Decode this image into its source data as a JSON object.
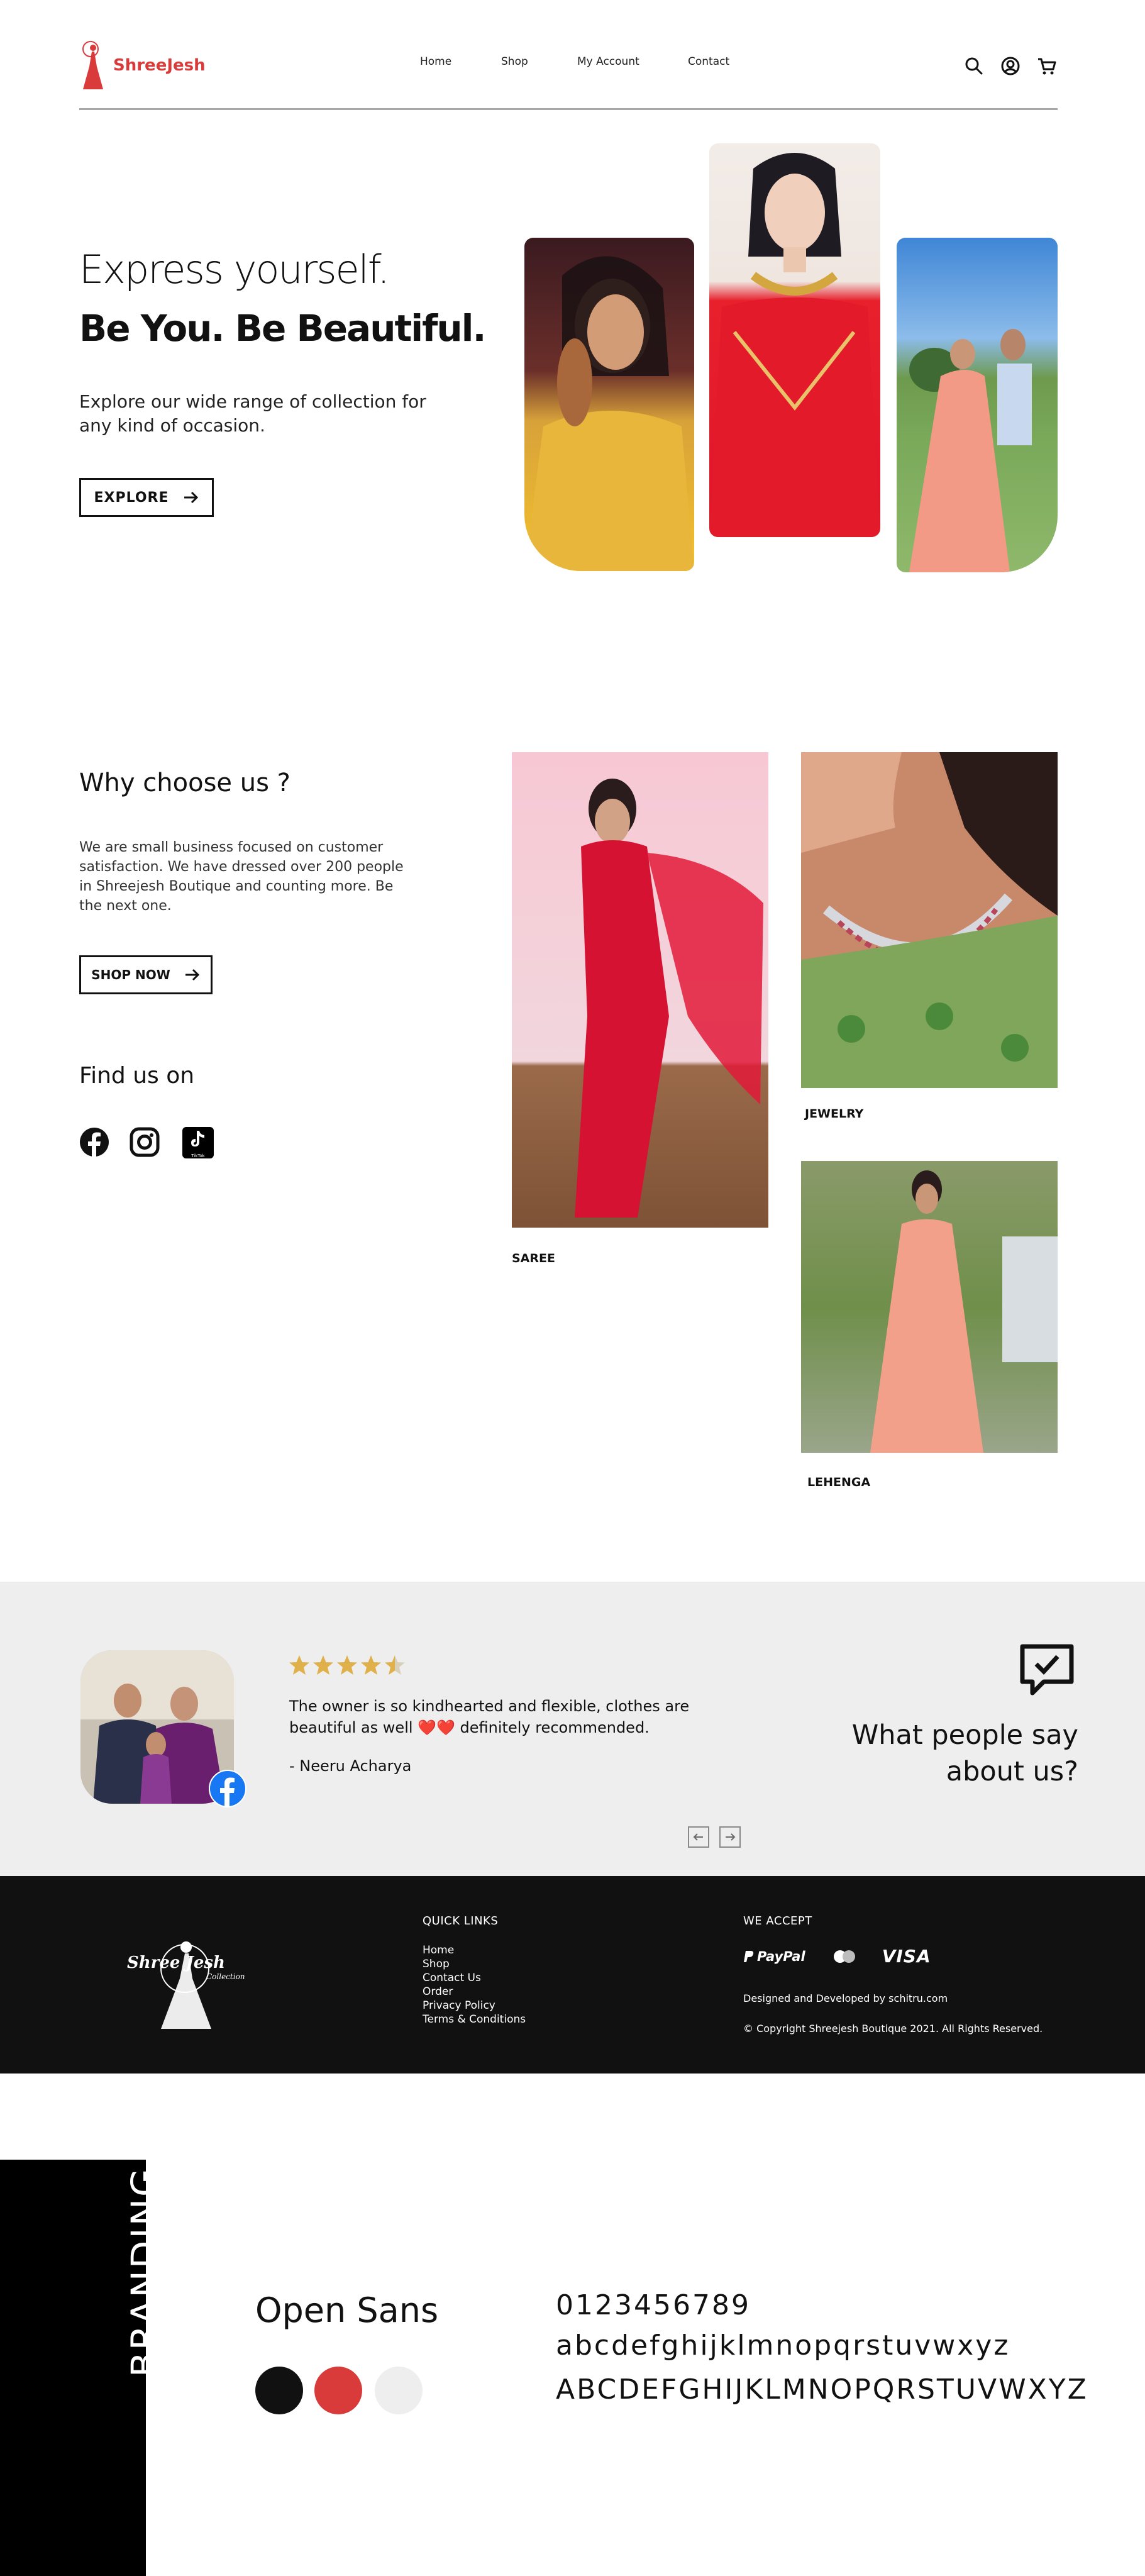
{
  "header": {
    "brand": "ShreeJesh",
    "nav": [
      "Home",
      "Shop",
      "My Account",
      "Contact"
    ]
  },
  "hero": {
    "line1": "Express yourself.",
    "line2": "Be You. Be Beautiful.",
    "description": "Explore our wide range of collection for any kind of occasion.",
    "cta": "EXPLORE"
  },
  "why": {
    "title": "Why choose us ?",
    "text": "We are small business focused on customer satisfaction. We have dressed over 200 people in Shreejesh Boutique and counting more. Be the next one.",
    "cta": "SHOP NOW",
    "find_title": "Find us on",
    "social": [
      "facebook-icon",
      "instagram-icon",
      "tiktok-icon"
    ],
    "tiktok_label": "TikTok"
  },
  "categories": {
    "saree": "SAREE",
    "jewelry": "JEWELRY",
    "lehenga": "LEHENGA"
  },
  "testimonial": {
    "rating": 4.5,
    "rating_max": 5,
    "quote": "The owner is so kindhearted and flexible, clothes are beautiful as well ❤️❤️ definitely recommended.",
    "author": "- Neeru Acharya",
    "title_line1": "What people say",
    "title_line2": "about us?"
  },
  "footer": {
    "logo_line1": "Shree Jesh",
    "logo_line2": "Collection",
    "quick_links_title": "QUICK LINKS",
    "quick_links": [
      "Home",
      "Shop",
      "Contact Us",
      "Order",
      "Privacy Policy",
      "Terms & Conditions"
    ],
    "we_accept_title": "WE ACCEPT",
    "payments": [
      "PayPal",
      "VISA"
    ],
    "designed_by": "Designed and Developed by schitru.com",
    "copyright": "© Copyright Shreejesh Boutique 2021.  All Rights Reserved."
  },
  "branding": {
    "label": "BRANDING",
    "font_name": "Open Sans",
    "digits": "0123456789",
    "lowercase": "abcdefghijklmnopqrstuvwxyz",
    "uppercase": "ABCDEFGHIJKLMNOPQRSTUVWXYZ",
    "colors": [
      "#111111",
      "#d93b3b",
      "#eeeeee"
    ]
  },
  "colors": {
    "brand_red": "#d93b3b",
    "footer_bg": "#111111",
    "section_gray": "#eeeeee",
    "star": "#e0b04a"
  }
}
